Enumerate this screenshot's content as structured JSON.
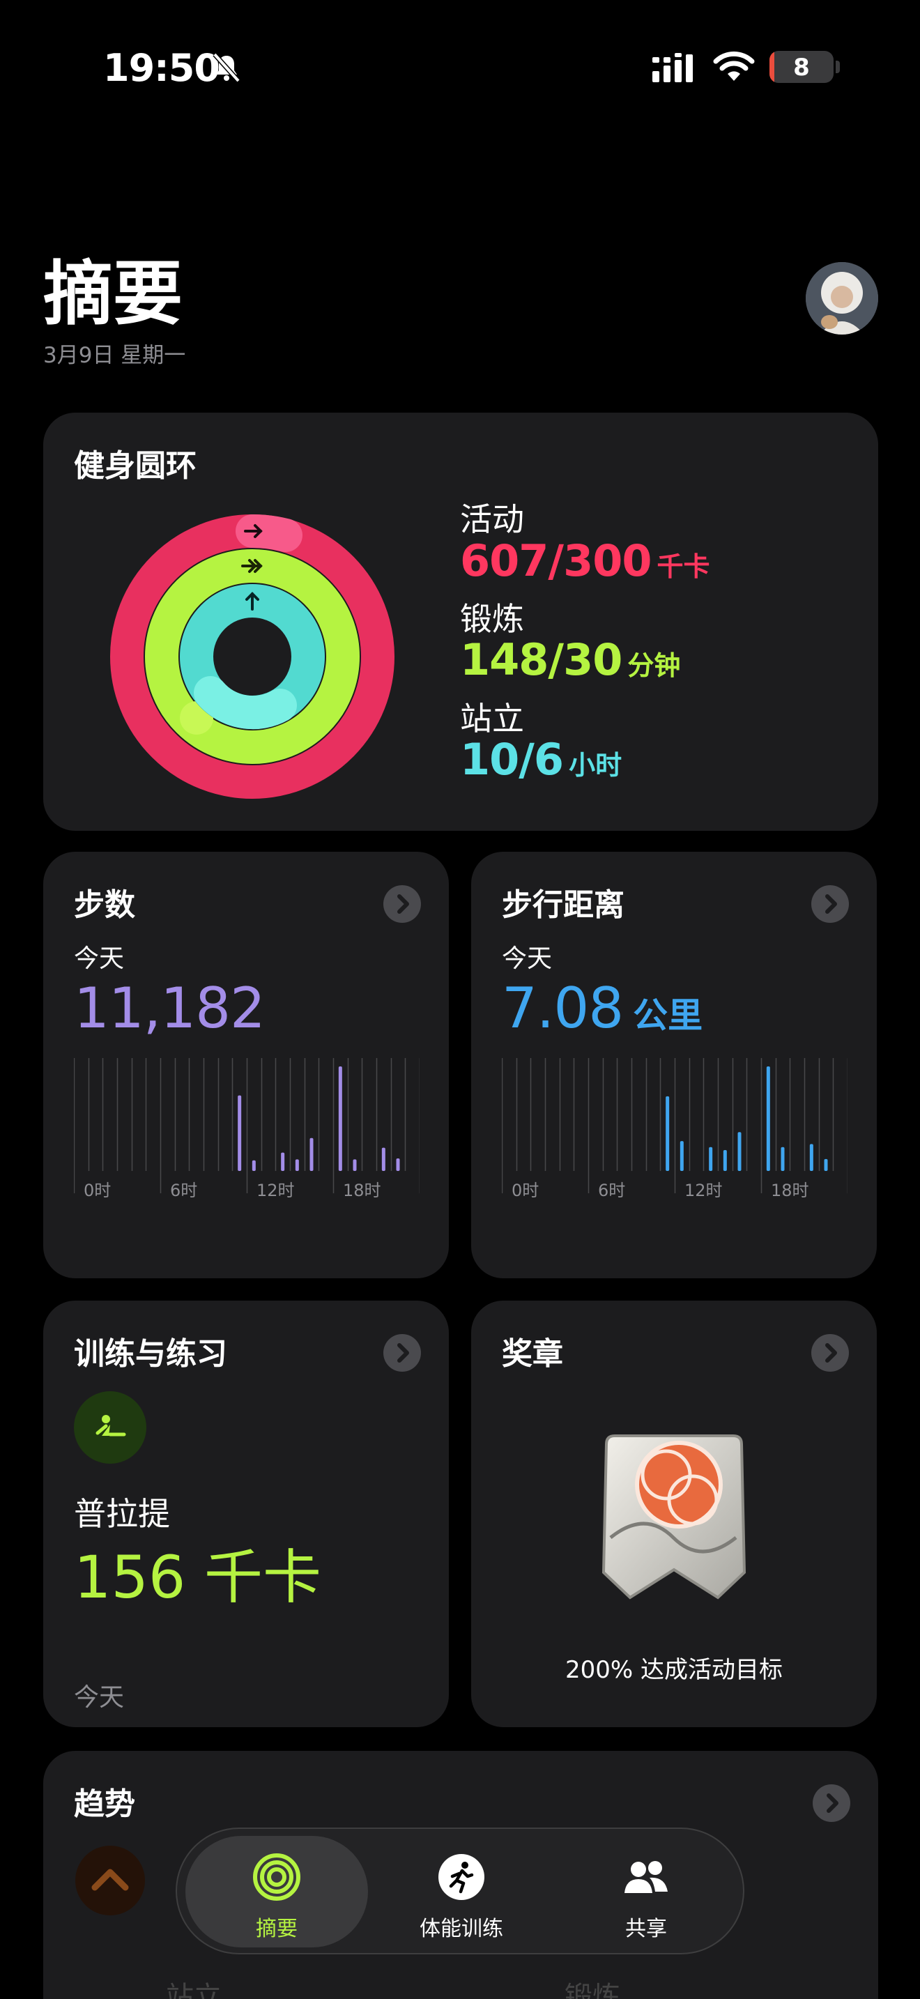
{
  "status_bar": {
    "time": "19:50",
    "battery": "8",
    "battery_level": 0.08
  },
  "header": {
    "title": "摘要",
    "date": "3月9日 星期一"
  },
  "rings": {
    "title": "健身圆环",
    "move": {
      "label": "活动",
      "value": "607/300",
      "unit": "千卡",
      "color": "#ff375f"
    },
    "exercise": {
      "label": "锻炼",
      "value": "148/30",
      "unit": "分钟",
      "color": "#b5f341"
    },
    "stand": {
      "label": "站立",
      "value": "10/6",
      "unit": "小时",
      "color": "#5ce1e6"
    }
  },
  "steps": {
    "title": "步数",
    "day": "今天",
    "value": "11,182",
    "color": "#a38de8",
    "axis": [
      "0时",
      "6时",
      "12时",
      "18时"
    ]
  },
  "distance": {
    "title": "步行距离",
    "day": "今天",
    "value": "7.08",
    "unit": "公里",
    "color": "#3fa6f0",
    "axis": [
      "0时",
      "6时",
      "12时",
      "18时"
    ]
  },
  "workouts": {
    "title": "训练与练习",
    "name": "普拉提",
    "value": "156 千卡",
    "day": "今天",
    "icon": "pilates-icon"
  },
  "awards": {
    "title": "奖章",
    "caption": "200% 达成活动目标"
  },
  "trends": {
    "title": "趋势",
    "item_a": "站立",
    "item_b": "锻炼"
  },
  "tab_bar": {
    "tabs": [
      {
        "label": "摘要",
        "icon": "rings-icon",
        "active": true
      },
      {
        "label": "体能训练",
        "icon": "runner-icon",
        "active": false
      },
      {
        "label": "共享",
        "icon": "people-icon",
        "active": false
      }
    ]
  },
  "chart_data": [
    {
      "type": "bar",
      "title": "步数",
      "xlabel": "",
      "ylabel": "",
      "categories": [
        "0",
        "1",
        "2",
        "3",
        "4",
        "5",
        "6",
        "7",
        "8",
        "9",
        "10",
        "11",
        "12",
        "13",
        "14",
        "15",
        "16",
        "17",
        "18",
        "19",
        "20",
        "21",
        "22",
        "23"
      ],
      "series": [
        {
          "values": [
            0,
            0,
            0,
            0,
            0,
            0,
            0,
            0,
            0,
            0,
            0,
            780,
            110,
            0,
            190,
            120,
            340,
            0,
            1080,
            120,
            0,
            240,
            130,
            0
          ]
        }
      ],
      "x_tick_labels": [
        "0时",
        "6时",
        "12时",
        "18时"
      ],
      "grid": true
    },
    {
      "type": "bar",
      "title": "步行距离",
      "xlabel": "",
      "ylabel": "",
      "categories": [
        "0",
        "1",
        "2",
        "3",
        "4",
        "5",
        "6",
        "7",
        "8",
        "9",
        "10",
        "11",
        "12",
        "13",
        "14",
        "15",
        "16",
        "17",
        "18",
        "19",
        "20",
        "21",
        "22",
        "23"
      ],
      "series": [
        {
          "values": [
            0,
            0,
            0,
            0,
            0,
            0,
            0,
            0,
            0,
            0,
            0,
            0.5,
            0.2,
            0,
            0.16,
            0.14,
            0.26,
            0,
            0.7,
            0.16,
            0,
            0.18,
            0.08,
            0
          ]
        }
      ],
      "x_tick_labels": [
        "0时",
        "6时",
        "12时",
        "18时"
      ],
      "grid": true
    }
  ]
}
